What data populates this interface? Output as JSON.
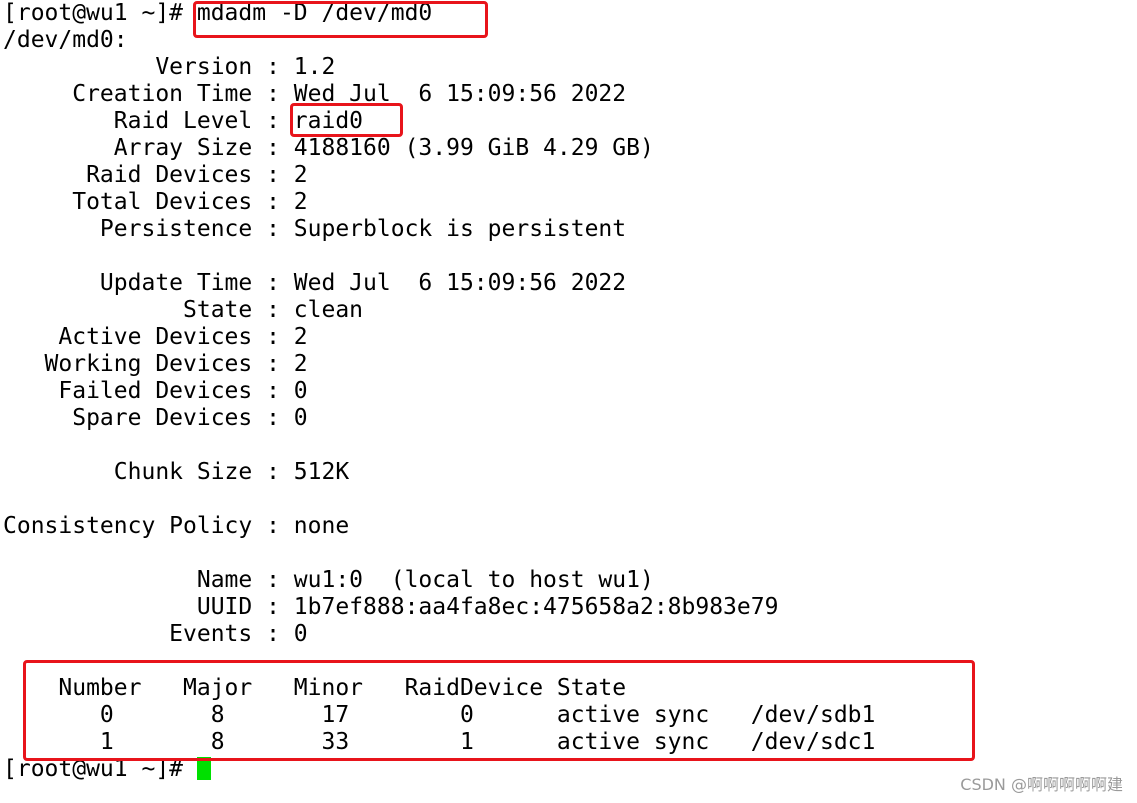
{
  "terminal": {
    "lines": [
      "[root@wu1 ~]# mdadm -D /dev/md0",
      "/dev/md0:",
      "           Version : 1.2",
      "     Creation Time : Wed Jul  6 15:09:56 2022",
      "        Raid Level : raid0",
      "        Array Size : 4188160 (3.99 GiB 4.29 GB)",
      "      Raid Devices : 2",
      "     Total Devices : 2",
      "       Persistence : Superblock is persistent",
      "",
      "       Update Time : Wed Jul  6 15:09:56 2022",
      "             State : clean",
      "    Active Devices : 2",
      "   Working Devices : 2",
      "    Failed Devices : 0",
      "     Spare Devices : 0",
      "",
      "        Chunk Size : 512K",
      "",
      "Consistency Policy : none",
      "",
      "              Name : wu1:0  (local to host wu1)",
      "              UUID : 1b7ef888:aa4fa8ec:475658a2:8b983e79",
      "            Events : 0",
      "",
      "    Number   Major   Minor   RaidDevice State",
      "       0       8       17        0      active sync   /dev/sdb1",
      "       1       8       33        1      active sync   /dev/sdc1"
    ],
    "prompt": "[root@wu1 ~]# "
  },
  "watermark": "CSDN @啊啊啊啊啊建",
  "colors": {
    "highlight_border": "#e8141b",
    "cursor": "#00e000"
  }
}
